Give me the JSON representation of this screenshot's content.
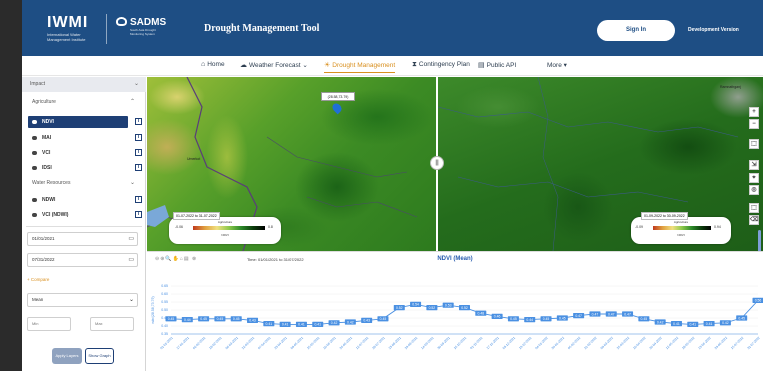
{
  "header": {
    "iwmi_logo_text": "IWMI",
    "iwmi_subtitle": "International Water Management Institute",
    "sadms_logo_text": "SADMS",
    "sadms_subtitle": "South Asia Drought Monitoring System",
    "title": "Drought Management Tool",
    "signin_label": "Sign In",
    "version_label": "Development Version",
    "bg_color": "#1e4e84"
  },
  "nav": {
    "items": [
      {
        "icon": "home-icon",
        "glyph": "⌂",
        "label": "Home"
      },
      {
        "icon": "weather-icon",
        "glyph": "☁",
        "label": "Weather Forecast ⌄"
      },
      {
        "icon": "drought-icon",
        "glyph": "☀",
        "label": "Drought Management"
      },
      {
        "icon": "hourglass-icon",
        "glyph": "⧗",
        "label": "Contingency Plan"
      },
      {
        "icon": "api-icon",
        "glyph": "▤",
        "label": "Public API"
      },
      {
        "icon": "",
        "glyph": "",
        "label": "More ▾"
      }
    ],
    "active_color": "#d99020"
  },
  "sidebar": {
    "impact_label": "Impact",
    "agriculture_label": "Agriculture",
    "agriculture_items": [
      "NDVI",
      "MAI",
      "VCI",
      "IDSI"
    ],
    "water_label": "Water Resources",
    "water_items": [
      "NDWI",
      "VCI (NDWI)"
    ],
    "start_date": "01/01/2021",
    "end_date": "07/31/2022",
    "compare_label": "+ Compare",
    "stat_select": "Mean",
    "min_placeholder": "Min",
    "max_placeholder": "Max",
    "apply_label": "Apply Layers",
    "graph_label": "Show Graph",
    "active_color": "#1e3f75"
  },
  "map": {
    "marker_label": "(28.58,73.79)",
    "place_left": "Umerkot",
    "place_right": "Ramnathganj",
    "legend_left": {
      "range": "01-07-2022 to 31-07-2022",
      "title": "Agriculture",
      "min": "-0.06",
      "max": "0.8",
      "name": "NDVI"
    },
    "legend_right": {
      "range": "01-09-2022 to 30-09-2022",
      "title": "Agriculture",
      "min": "-0.09",
      "max": "0.94",
      "name": "NDVI"
    },
    "controls": [
      "+",
      "−",
      "⌖",
      "◎",
      "⬚",
      "⌫",
      "⇲"
    ]
  },
  "chart_panel": {
    "time_text": "Time: 01/01/2021 to 31/07/2022",
    "title": "NDVI (Mean)",
    "toolbar": "⊖⊕🔍✋⌂▤ ⊗"
  },
  "chart_data": {
    "type": "line",
    "title": "NDVI (Mean)",
    "ylabel": "ndvi(28.58,73.79)",
    "ylim": [
      0.35,
      0.65
    ],
    "yticks": [
      0.35,
      0.4,
      0.45,
      0.5,
      0.55,
      0.6,
      0.65
    ],
    "x": [
      "01-01-2021",
      "17-01-2021",
      "02-02-2021",
      "18-02-2021",
      "06-03-2021",
      "22-03-2021",
      "07-04-2021",
      "23-04-2021",
      "09-05-2021",
      "25-05-2021",
      "10-06-2021",
      "26-06-2021",
      "12-07-2021",
      "28-07-2021",
      "13-08-2021",
      "29-08-2021",
      "14-09-2021",
      "30-09-2021",
      "16-10-2021",
      "01-11-2021",
      "17-11-2021",
      "03-12-2021",
      "19-12-2021",
      "04-01-2022",
      "20-01-2022",
      "05-02-2022",
      "21-02-2022",
      "09-03-2022",
      "25-03-2022",
      "10-04-2022",
      "26-04-2022",
      "12-05-2022",
      "28-05-2022",
      "13-06-2022",
      "29-06-2022",
      "15-07-2022",
      "31-07-2022"
    ],
    "series": [
      {
        "values": [
          0.445,
          0.44,
          0.445,
          0.445,
          0.445,
          0.435,
          0.415,
          0.41,
          0.41,
          0.41,
          0.42,
          0.425,
          0.435,
          0.445,
          0.515,
          0.535,
          0.515,
          0.53,
          0.515,
          0.48,
          0.46,
          0.445,
          0.44,
          0.445,
          0.45,
          0.465,
          0.475,
          0.475,
          0.475,
          0.445,
          0.425,
          0.415,
          0.41,
          0.415,
          0.42,
          0.45,
          0.56
        ],
        "color": "#4a90e2"
      }
    ]
  }
}
